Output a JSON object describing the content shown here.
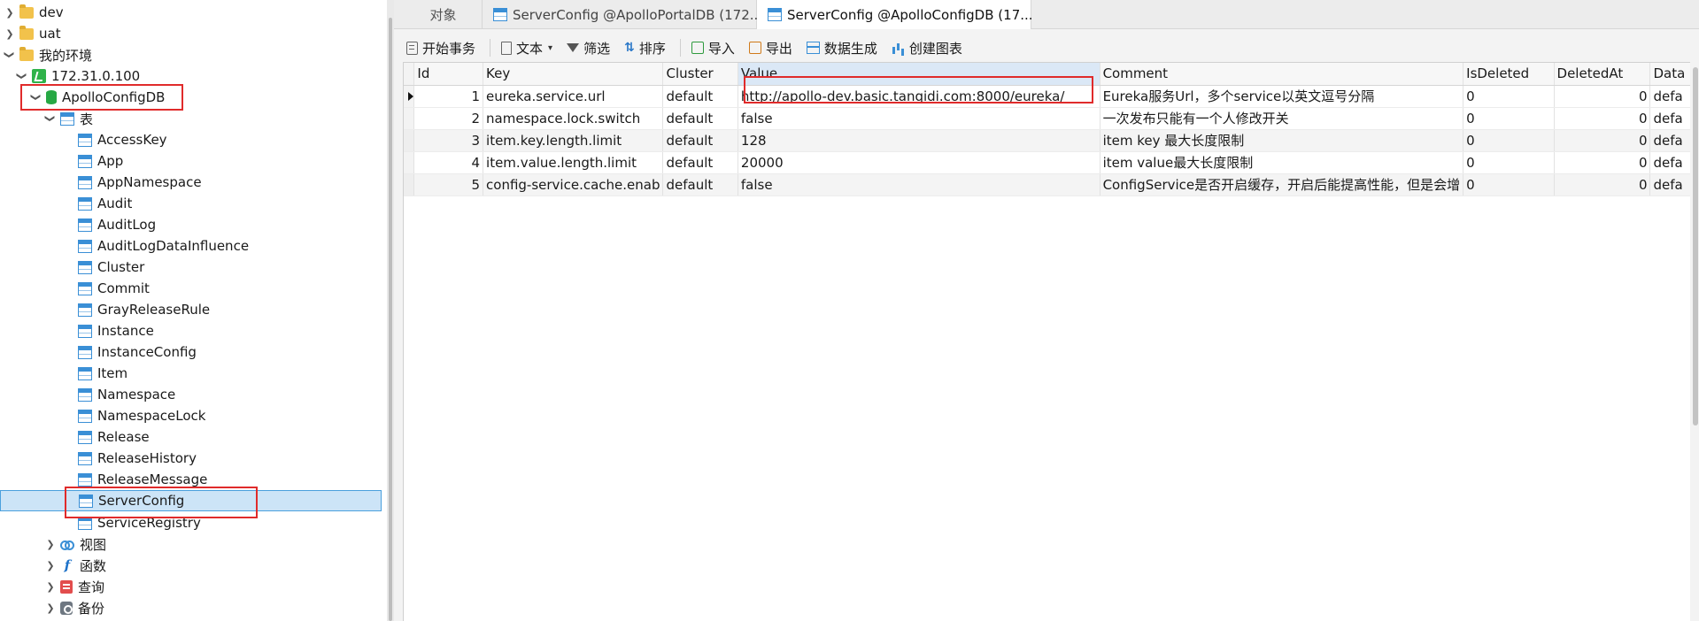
{
  "tree": {
    "dev": "dev",
    "uat": "uat",
    "my_env": "我的环境",
    "connection": "172.31.0.100",
    "database": "ApolloConfigDB",
    "tables_group": "表",
    "tables": [
      "AccessKey",
      "App",
      "AppNamespace",
      "Audit",
      "AuditLog",
      "AuditLogDataInfluence",
      "Cluster",
      "Commit",
      "GrayReleaseRule",
      "Instance",
      "InstanceConfig",
      "Item",
      "Namespace",
      "NamespaceLock",
      "Release",
      "ReleaseHistory",
      "ReleaseMessage",
      "ServerConfig",
      "ServiceRegistry"
    ],
    "views": "视图",
    "functions": "函数",
    "queries": "查询",
    "backups": "备份"
  },
  "tabs": {
    "objects": "对象",
    "tab2": "ServerConfig @ApolloPortalDB (172....",
    "tab3": "ServerConfig @ApolloConfigDB (17..."
  },
  "toolbar": {
    "begin_transaction": "开始事务",
    "text": "文本",
    "filter": "筛选",
    "sort": "排序",
    "import": "导入",
    "export": "导出",
    "data_gen": "数据生成",
    "create_chart": "创建图表"
  },
  "grid": {
    "columns": [
      "Id",
      "Key",
      "Cluster",
      "Value",
      "Comment",
      "IsDeleted",
      "DeletedAt",
      "Data"
    ],
    "rows": [
      [
        "1",
        "eureka.service.url",
        "default",
        "http://apollo-dev.basic.tanqidi.com:8000/eureka/",
        "Eureka服务Url，多个service以英文逗号分隔",
        "0",
        "0",
        "defa"
      ],
      [
        "2",
        "namespace.lock.switch",
        "default",
        "false",
        "一次发布只能有一个人修改开关",
        "0",
        "0",
        "defa"
      ],
      [
        "3",
        "item.key.length.limit",
        "default",
        "128",
        "item key 最大长度限制",
        "0",
        "0",
        "defa"
      ],
      [
        "4",
        "item.value.length.limit",
        "default",
        "20000",
        "item value最大长度限制",
        "0",
        "0",
        "defa"
      ],
      [
        "5",
        "config-service.cache.enab",
        "default",
        "false",
        "ConfigService是否开启缓存，开启后能提高性能，但是会增",
        "0",
        "0",
        "defa"
      ]
    ]
  },
  "colors": {
    "highlight": "#e02b2b",
    "selection": "#cce4f7",
    "db_icon": "#27a844",
    "table_icon": "#3a8fd6"
  }
}
